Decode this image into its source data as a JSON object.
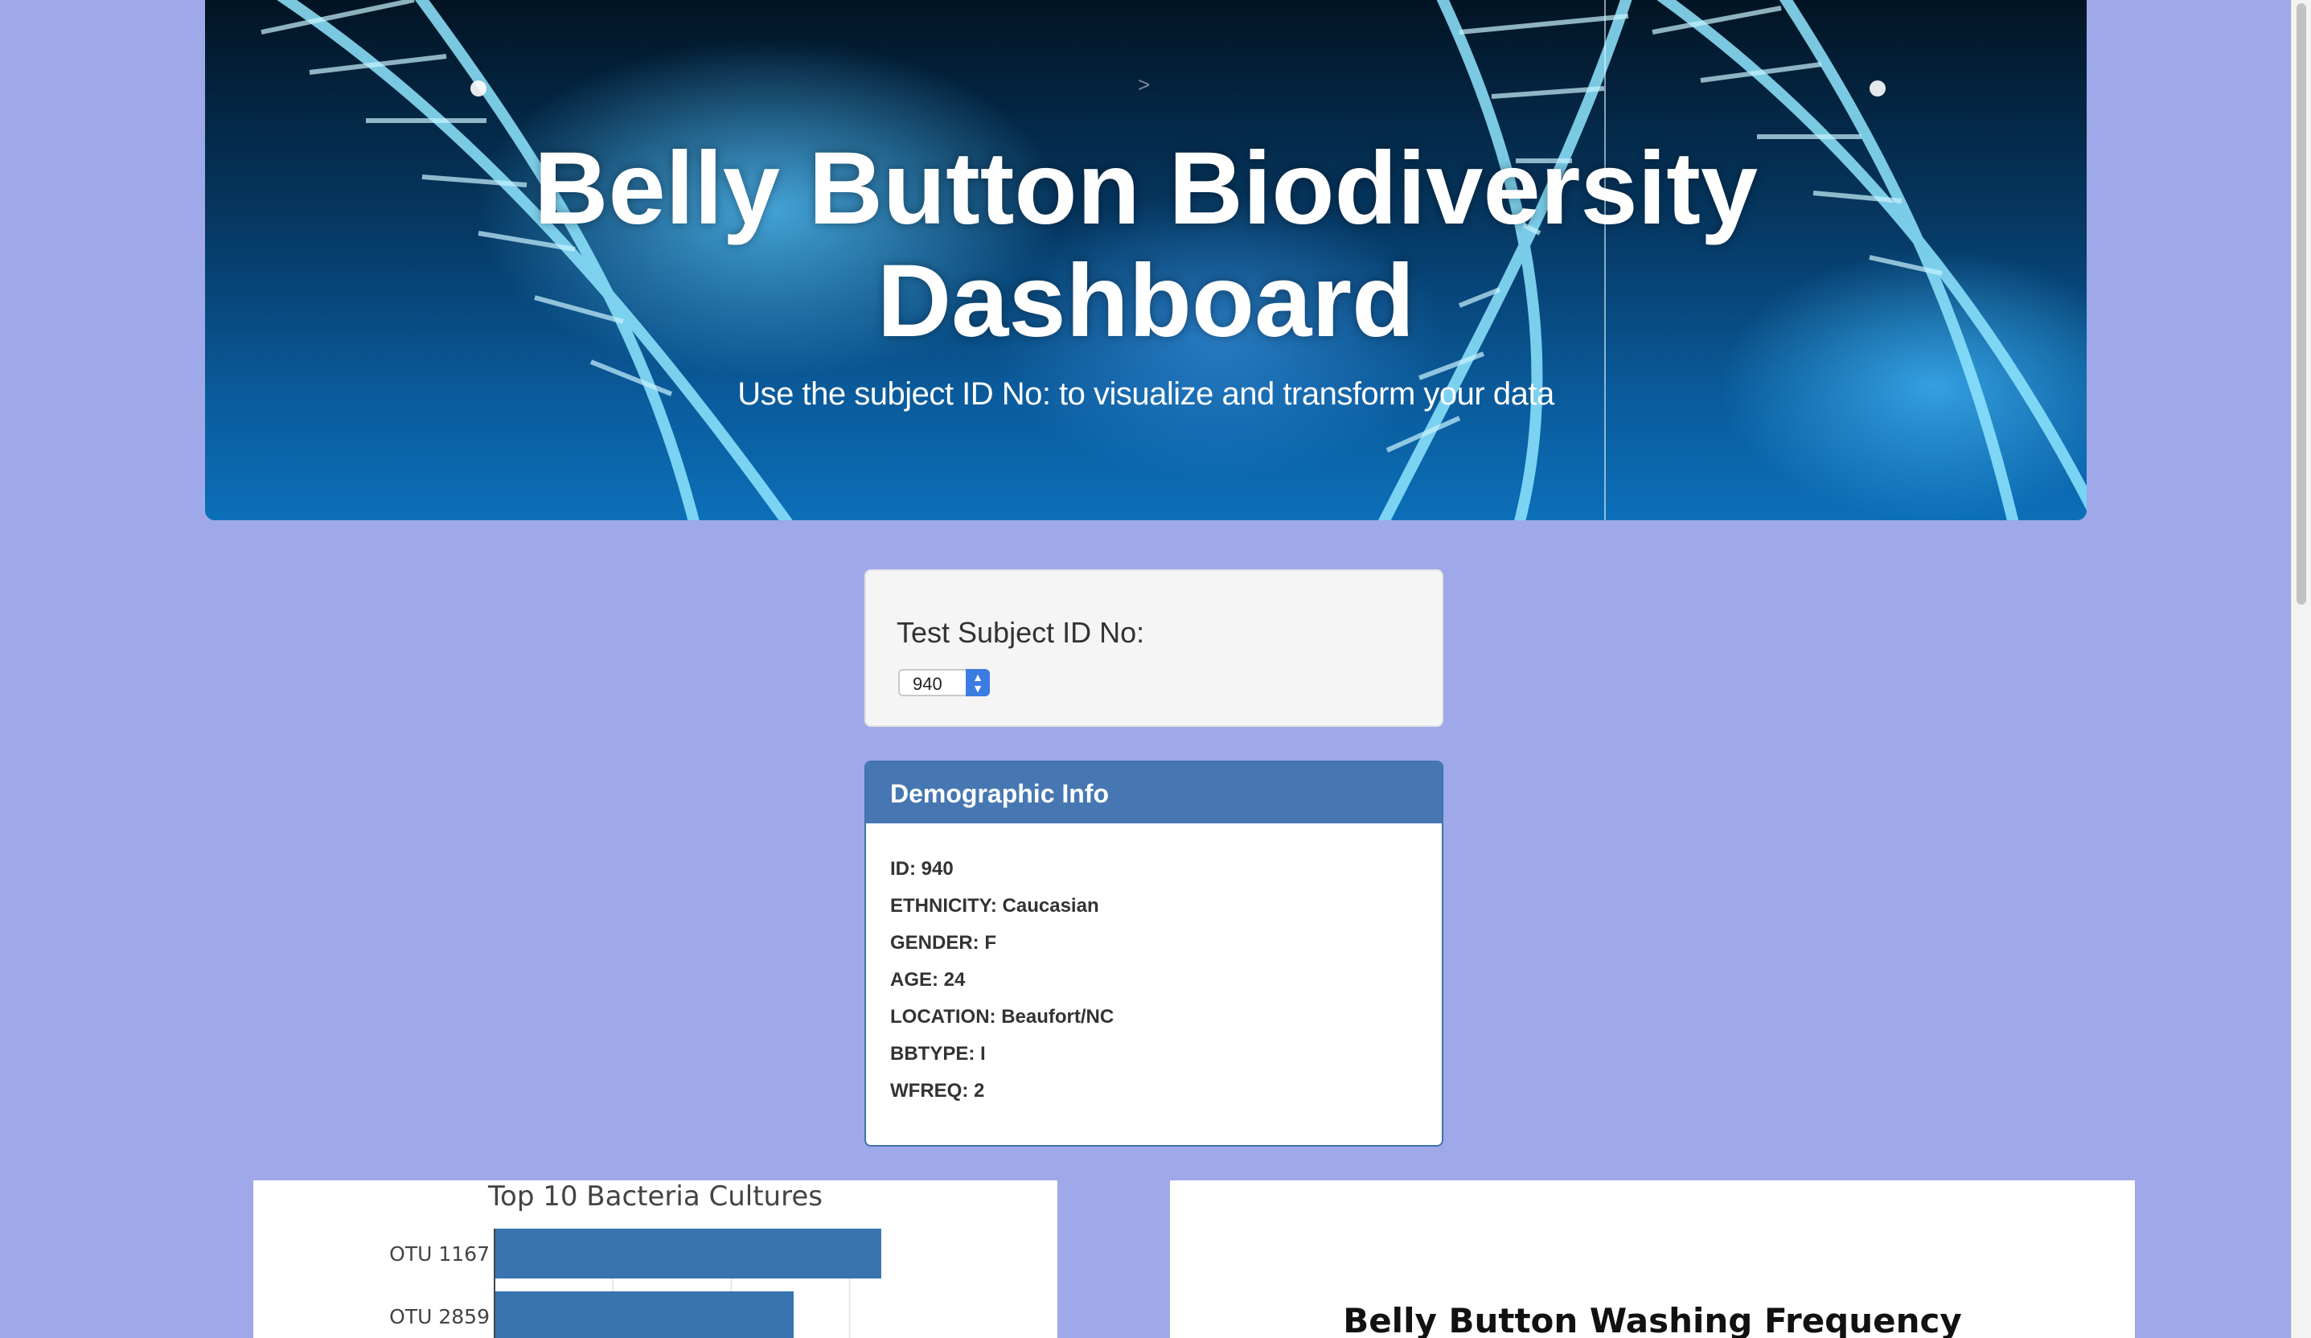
{
  "header": {
    "title_line1": "Belly Button Biodiversity",
    "title_line2": "Dashboard",
    "subtitle": "Use the subject ID No: to visualize and transform your data",
    "caret": ">"
  },
  "selector": {
    "label": "Test Subject ID No:",
    "selected_value": "940"
  },
  "demographic": {
    "heading": "Demographic Info",
    "lines": [
      "ID: 940",
      "ETHNICITY: Caucasian",
      "GENDER: F",
      "AGE: 24",
      "LOCATION: Beaufort/NC",
      "BBTYPE: I",
      "WFREQ: 2"
    ]
  },
  "gauge": {
    "title": "Belly Button Washing Frequency"
  },
  "colors": {
    "page_background": "#9fa8e8",
    "panel_heading": "#4677b2",
    "bar": "#3a74b0"
  },
  "chart_data": {
    "type": "bar",
    "orientation": "horizontal",
    "title": "Top 10 Bacteria Cultures",
    "categories": [
      "OTU 1167",
      "OTU 2859"
    ],
    "values": [
      163,
      126
    ],
    "xlim": [
      0,
      180
    ],
    "grid": true
  }
}
